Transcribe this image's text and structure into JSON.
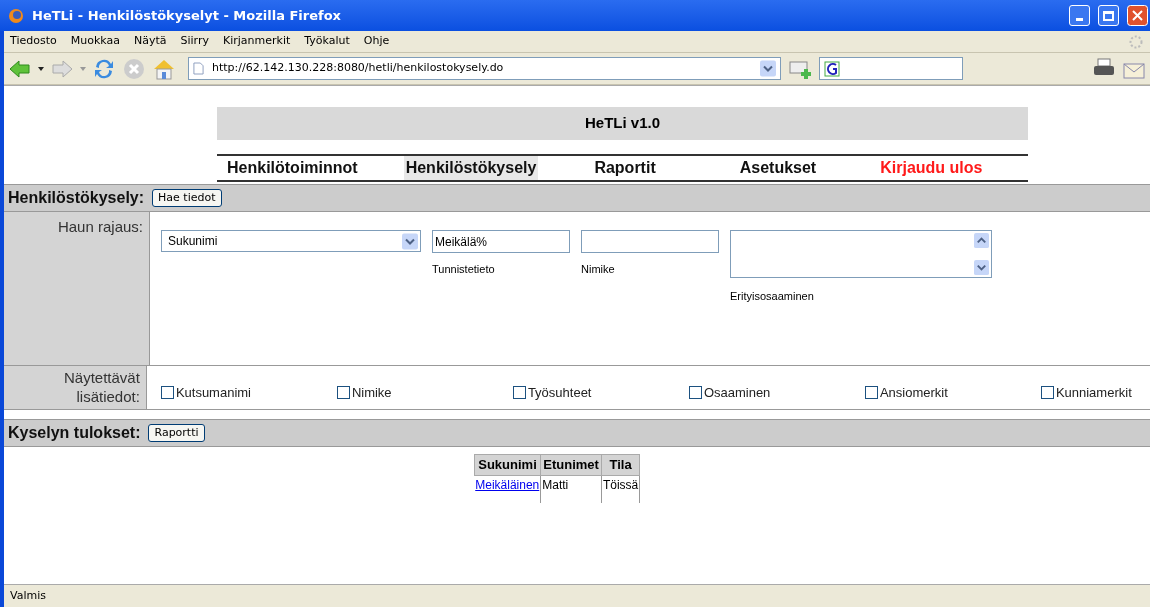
{
  "window": {
    "title": "HeTLi - Henkilöstökyselyt - Mozilla Firefox"
  },
  "menu": [
    "Tiedosto",
    "Muokkaa",
    "Näytä",
    "Siirry",
    "Kirjanmerkit",
    "Työkalut",
    "Ohje"
  ],
  "address": {
    "value": "http://62.142.130.228:8080/hetli/henkilostokysely.do"
  },
  "app_title": "HeTLi v1.0",
  "nav": [
    {
      "label": "Henkilötoiminnot",
      "selected": false,
      "kind": "normal"
    },
    {
      "label": "Henkilöstökysely",
      "selected": true,
      "kind": "normal"
    },
    {
      "label": "Raportit",
      "selected": false,
      "kind": "normal"
    },
    {
      "label": "Asetukset",
      "selected": false,
      "kind": "normal"
    },
    {
      "label": "Kirjaudu ulos",
      "selected": false,
      "kind": "logout"
    }
  ],
  "query": {
    "heading": "Henkilöstökysely:",
    "button": "Hae tiedot",
    "filter_label": "Haun rajaus:",
    "select_value": "Sukunimi",
    "fields": [
      {
        "value": "Meikälä%",
        "caption": "Tunnistetieto"
      },
      {
        "caption": "Nimike"
      }
    ],
    "textarea_caption": "Erityisosaaminen",
    "extra_label": "Näytettävät lisätiedot:",
    "checkboxes": [
      {
        "label": "Kutsumanimi",
        "checked": false
      },
      {
        "label": "Nimike",
        "checked": false
      },
      {
        "label": "Työsuhteet",
        "checked": false
      },
      {
        "label": "Osaaminen",
        "checked": false
      },
      {
        "label": "Ansiomerkit",
        "checked": false
      },
      {
        "label": "Kunniamerkit",
        "checked": false
      }
    ]
  },
  "results": {
    "heading": "Kyselyn tulokset:",
    "button": "Raportti",
    "table": {
      "columns": [
        "Sukunimi",
        "Etunimet",
        "Tila"
      ],
      "rows": [
        [
          "Meikäläinen",
          "Matti",
          "Töissä"
        ]
      ]
    }
  },
  "status_bar": "Valmis"
}
